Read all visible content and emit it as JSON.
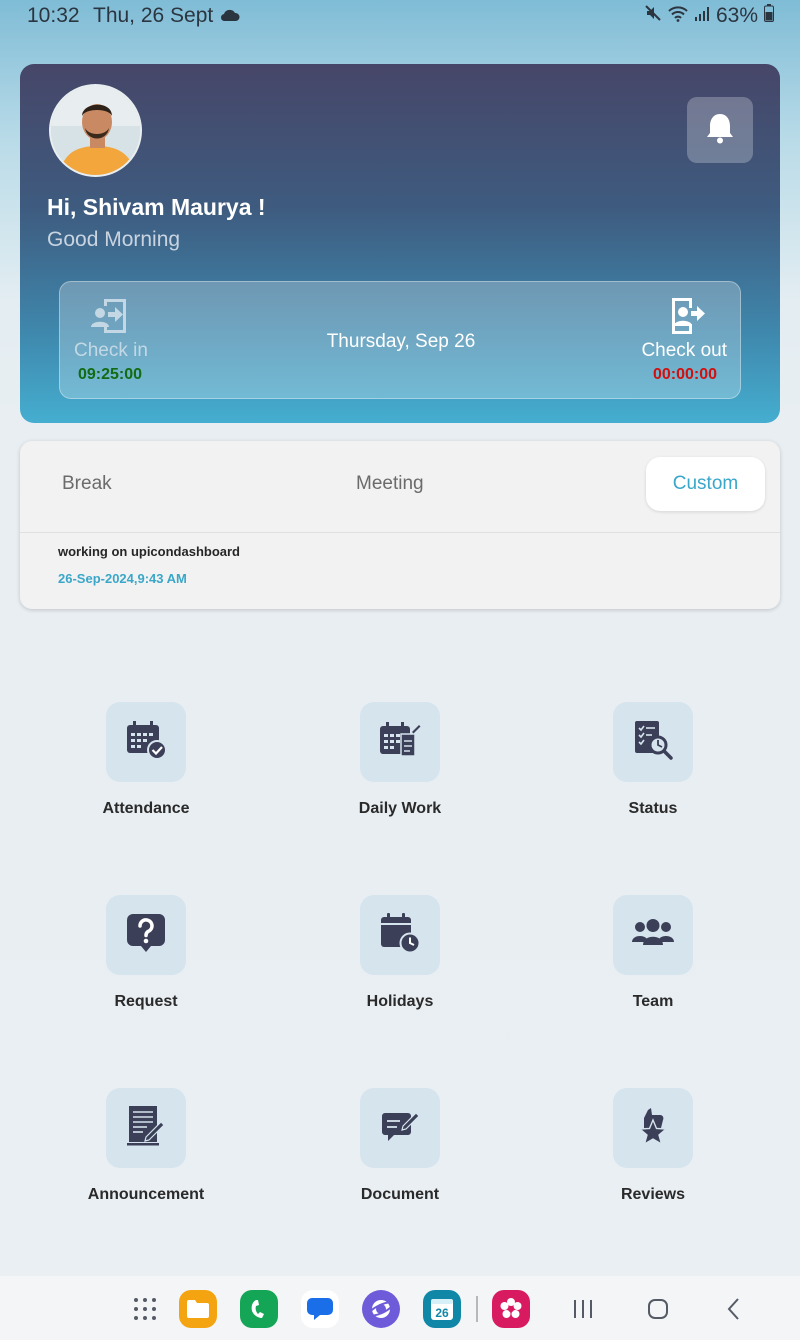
{
  "status_bar": {
    "time": "10:32",
    "date": "Thu, 26 Sept",
    "battery": "63%"
  },
  "header": {
    "greeting": "Hi, Shivam Maurya !",
    "subtitle": "Good Morning",
    "date": "Thursday, Sep 26",
    "check_in": {
      "label": "Check in",
      "time": "09:25:00"
    },
    "check_out": {
      "label": "Check out",
      "time": "00:00:00"
    }
  },
  "tabs": {
    "items": [
      "Break",
      "Meeting",
      "Custom"
    ],
    "active": "Custom",
    "note": {
      "text": "working on upicondashboard",
      "timestamp": "26-Sep-2024,9:43 AM"
    }
  },
  "menu": [
    {
      "label": "Attendance",
      "icon": "calendar-check-icon"
    },
    {
      "label": "Daily Work",
      "icon": "calendar-edit-icon"
    },
    {
      "label": "Status",
      "icon": "report-search-icon"
    },
    {
      "label": "Request",
      "icon": "question-bubble-icon"
    },
    {
      "label": "Holidays",
      "icon": "calendar-clock-icon"
    },
    {
      "label": "Team",
      "icon": "team-icon"
    },
    {
      "label": "Announcement",
      "icon": "document-pen-icon"
    },
    {
      "label": "Document",
      "icon": "message-edit-icon"
    },
    {
      "label": "Reviews",
      "icon": "star-thumb-icon"
    }
  ],
  "navbar": {
    "calendar_day": "26"
  },
  "colors": {
    "accent": "#3aa7c9",
    "check_in_time": "#126b12",
    "check_out_time": "#d20f0f",
    "icon_tile": "#d6e4ed",
    "icon_fill": "#3b3f58"
  }
}
